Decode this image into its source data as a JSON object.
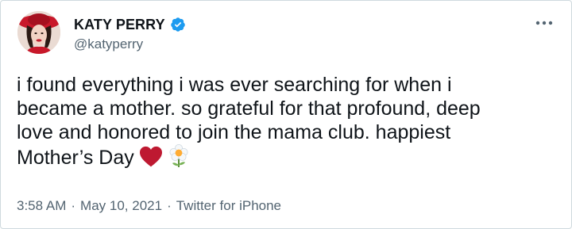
{
  "author": {
    "display_name": "KATY PERRY",
    "handle": "@katyperry",
    "verified": true
  },
  "icons": {
    "verified": "verified-badge-icon",
    "more": "more-options-icon",
    "heart": "red-heart-emoji",
    "flower": "blossom-emoji"
  },
  "colors": {
    "verified_blue": "#1d9bf0",
    "heart_red": "#be1931",
    "text_primary": "#0f1419",
    "text_secondary": "#536471"
  },
  "tweet": {
    "lines": [
      "i found everything i was ever searching for when i",
      "became a mother. so grateful for that profound, deep",
      "love and honored to join the mama club. happiest",
      "Mother’s Day"
    ]
  },
  "meta": {
    "time": "3:58 AM",
    "separator": "·",
    "date": "May 10, 2021",
    "source": "Twitter for iPhone"
  }
}
